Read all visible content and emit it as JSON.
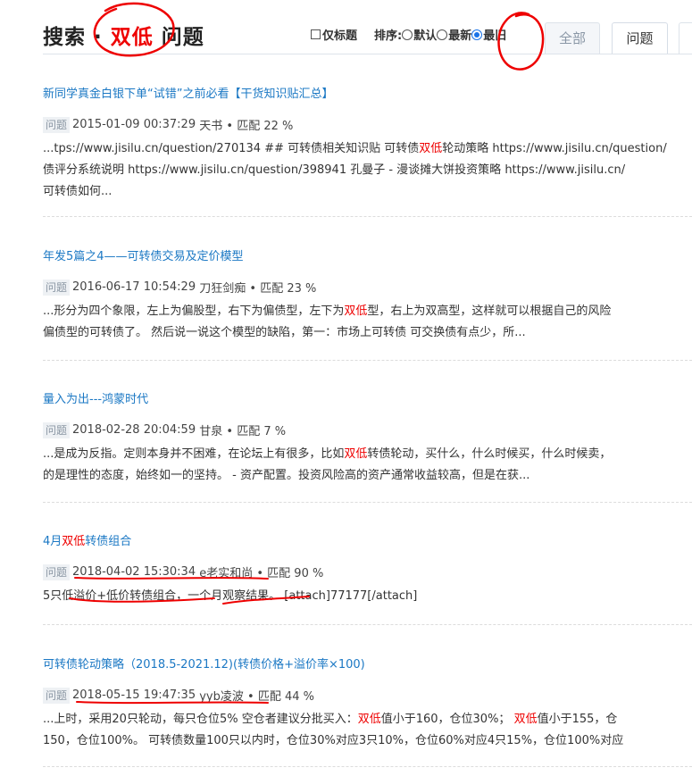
{
  "header": {
    "title_prefix": "搜索 · ",
    "keyword": "双低",
    "title_suffix": " 问题",
    "title_only_label": "仅标题",
    "sort_label": "排序:",
    "sort_options": [
      "默认",
      "最新",
      "最旧"
    ],
    "sort_selected": "最旧",
    "tabs": [
      "全部",
      "问题"
    ],
    "active_tab": "问题"
  },
  "badge_label": "问题",
  "results": [
    {
      "title": "新同学真金白银下单“试错”之前必看【干货知识贴汇总】",
      "date": "2015-01-09 00:37:29",
      "author": "天书",
      "match": "• 匹配 22 %",
      "line1_pre": "...tps://www.jisilu.cn/question/270134 ## 可转债相关知识贴 可转债",
      "line1_hl": "双低",
      "line1_post": "轮动策略 https://www.jisilu.cn/question/",
      "line2": "债评分系统说明 https://www.jisilu.cn/question/398941 孔曼子 - 漫谈摊大饼投资策略 https://www.jisilu.cn/",
      "line3": "可转债如何..."
    },
    {
      "title": "年发5篇之4——可转债交易及定价模型",
      "date": "2016-06-17 10:54:29",
      "author": "刀狂剑痴",
      "match": "• 匹配 23 %",
      "line1_pre": "...形分为四个象限，左上为偏股型，右下为偏债型，左下为",
      "line1_hl": "双低",
      "line1_post": "型，右上为双高型，这样就可以根据自己的风险",
      "line2": "偏债型的可转债了。 然后说一说这个模型的缺陷，第一：市场上可转债 可交换债有点少，所..."
    },
    {
      "title": "量入为出---鸿蒙时代",
      "date": "2018-02-28 20:04:59",
      "author": "甘泉",
      "match": "• 匹配 7 %",
      "line1_pre": "...是成为反指。定则本身并不困难，在论坛上有很多，比如",
      "line1_hl": "双低",
      "line1_post": "转债轮动，买什么，什么时候买，什么时候卖，",
      "line2": "的是理性的态度，始终如一的坚持。 - 资产配置。投资风险高的资产通常收益较高，但是在获..."
    },
    {
      "title_pre": "4月",
      "title_hl": "双低",
      "title_post": "转债组合",
      "date": "2018-04-02 15:30:34",
      "author": "e老实和尚",
      "match": "• 匹配 90 %",
      "line1": "5只低溢价+低价转债组合，一个月观察结果。 [attach]77177[/attach]"
    },
    {
      "title": "可转债轮动策略（2018.5-2021.12)(转债价格+溢价率×100)",
      "date": "2018-05-15 19:47:35",
      "author": "yyb凌波",
      "match": "• 匹配 44 %",
      "line1_a": "...上时，采用20只轮动，每只仓位5% 空仓者建议分批买入：",
      "line1_hl1": "双低",
      "line1_b": "值小于160，仓位30%； ",
      "line1_hl2": "双低",
      "line1_c": "值小于155，仓",
      "line2": "150，仓位100%。 可转债数量100只以内时，仓位30%对应3只10%，仓位60%对应4只15%，仓位100%对应"
    }
  ]
}
